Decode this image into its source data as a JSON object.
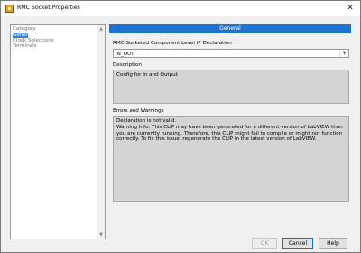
{
  "window": {
    "title": "RMC Socket Properties",
    "close_glyph": "✕"
  },
  "category": {
    "header": "Category",
    "items": [
      {
        "label": "General",
        "selected": true
      },
      {
        "label": "Clock Selections",
        "selected": false
      },
      {
        "label": "Terminals",
        "selected": false
      }
    ]
  },
  "general": {
    "section_title": "General",
    "ip_decl_label": "RMC Socketed Component Level IP Declaration",
    "ip_decl_value": "IN_OUT",
    "description_label": "Description",
    "description_text": "Config for In and Output",
    "errors_label": "Errors and Warnings",
    "errors_line1": "Declaration is not valid.",
    "errors_line2": "Warning Info: This CLIP may have been generated for a different version of LabVIEW than you are currently running. Therefore, this CLIP might fail to compile or might not function correctly. To fix this issue, regenerate the CLIP in the latest version of LabVIEW."
  },
  "buttons": {
    "ok": "OK",
    "cancel": "Cancel",
    "help": "Help"
  },
  "colors": {
    "accent": "#1f72cf",
    "selection": "#3b7fd2"
  }
}
